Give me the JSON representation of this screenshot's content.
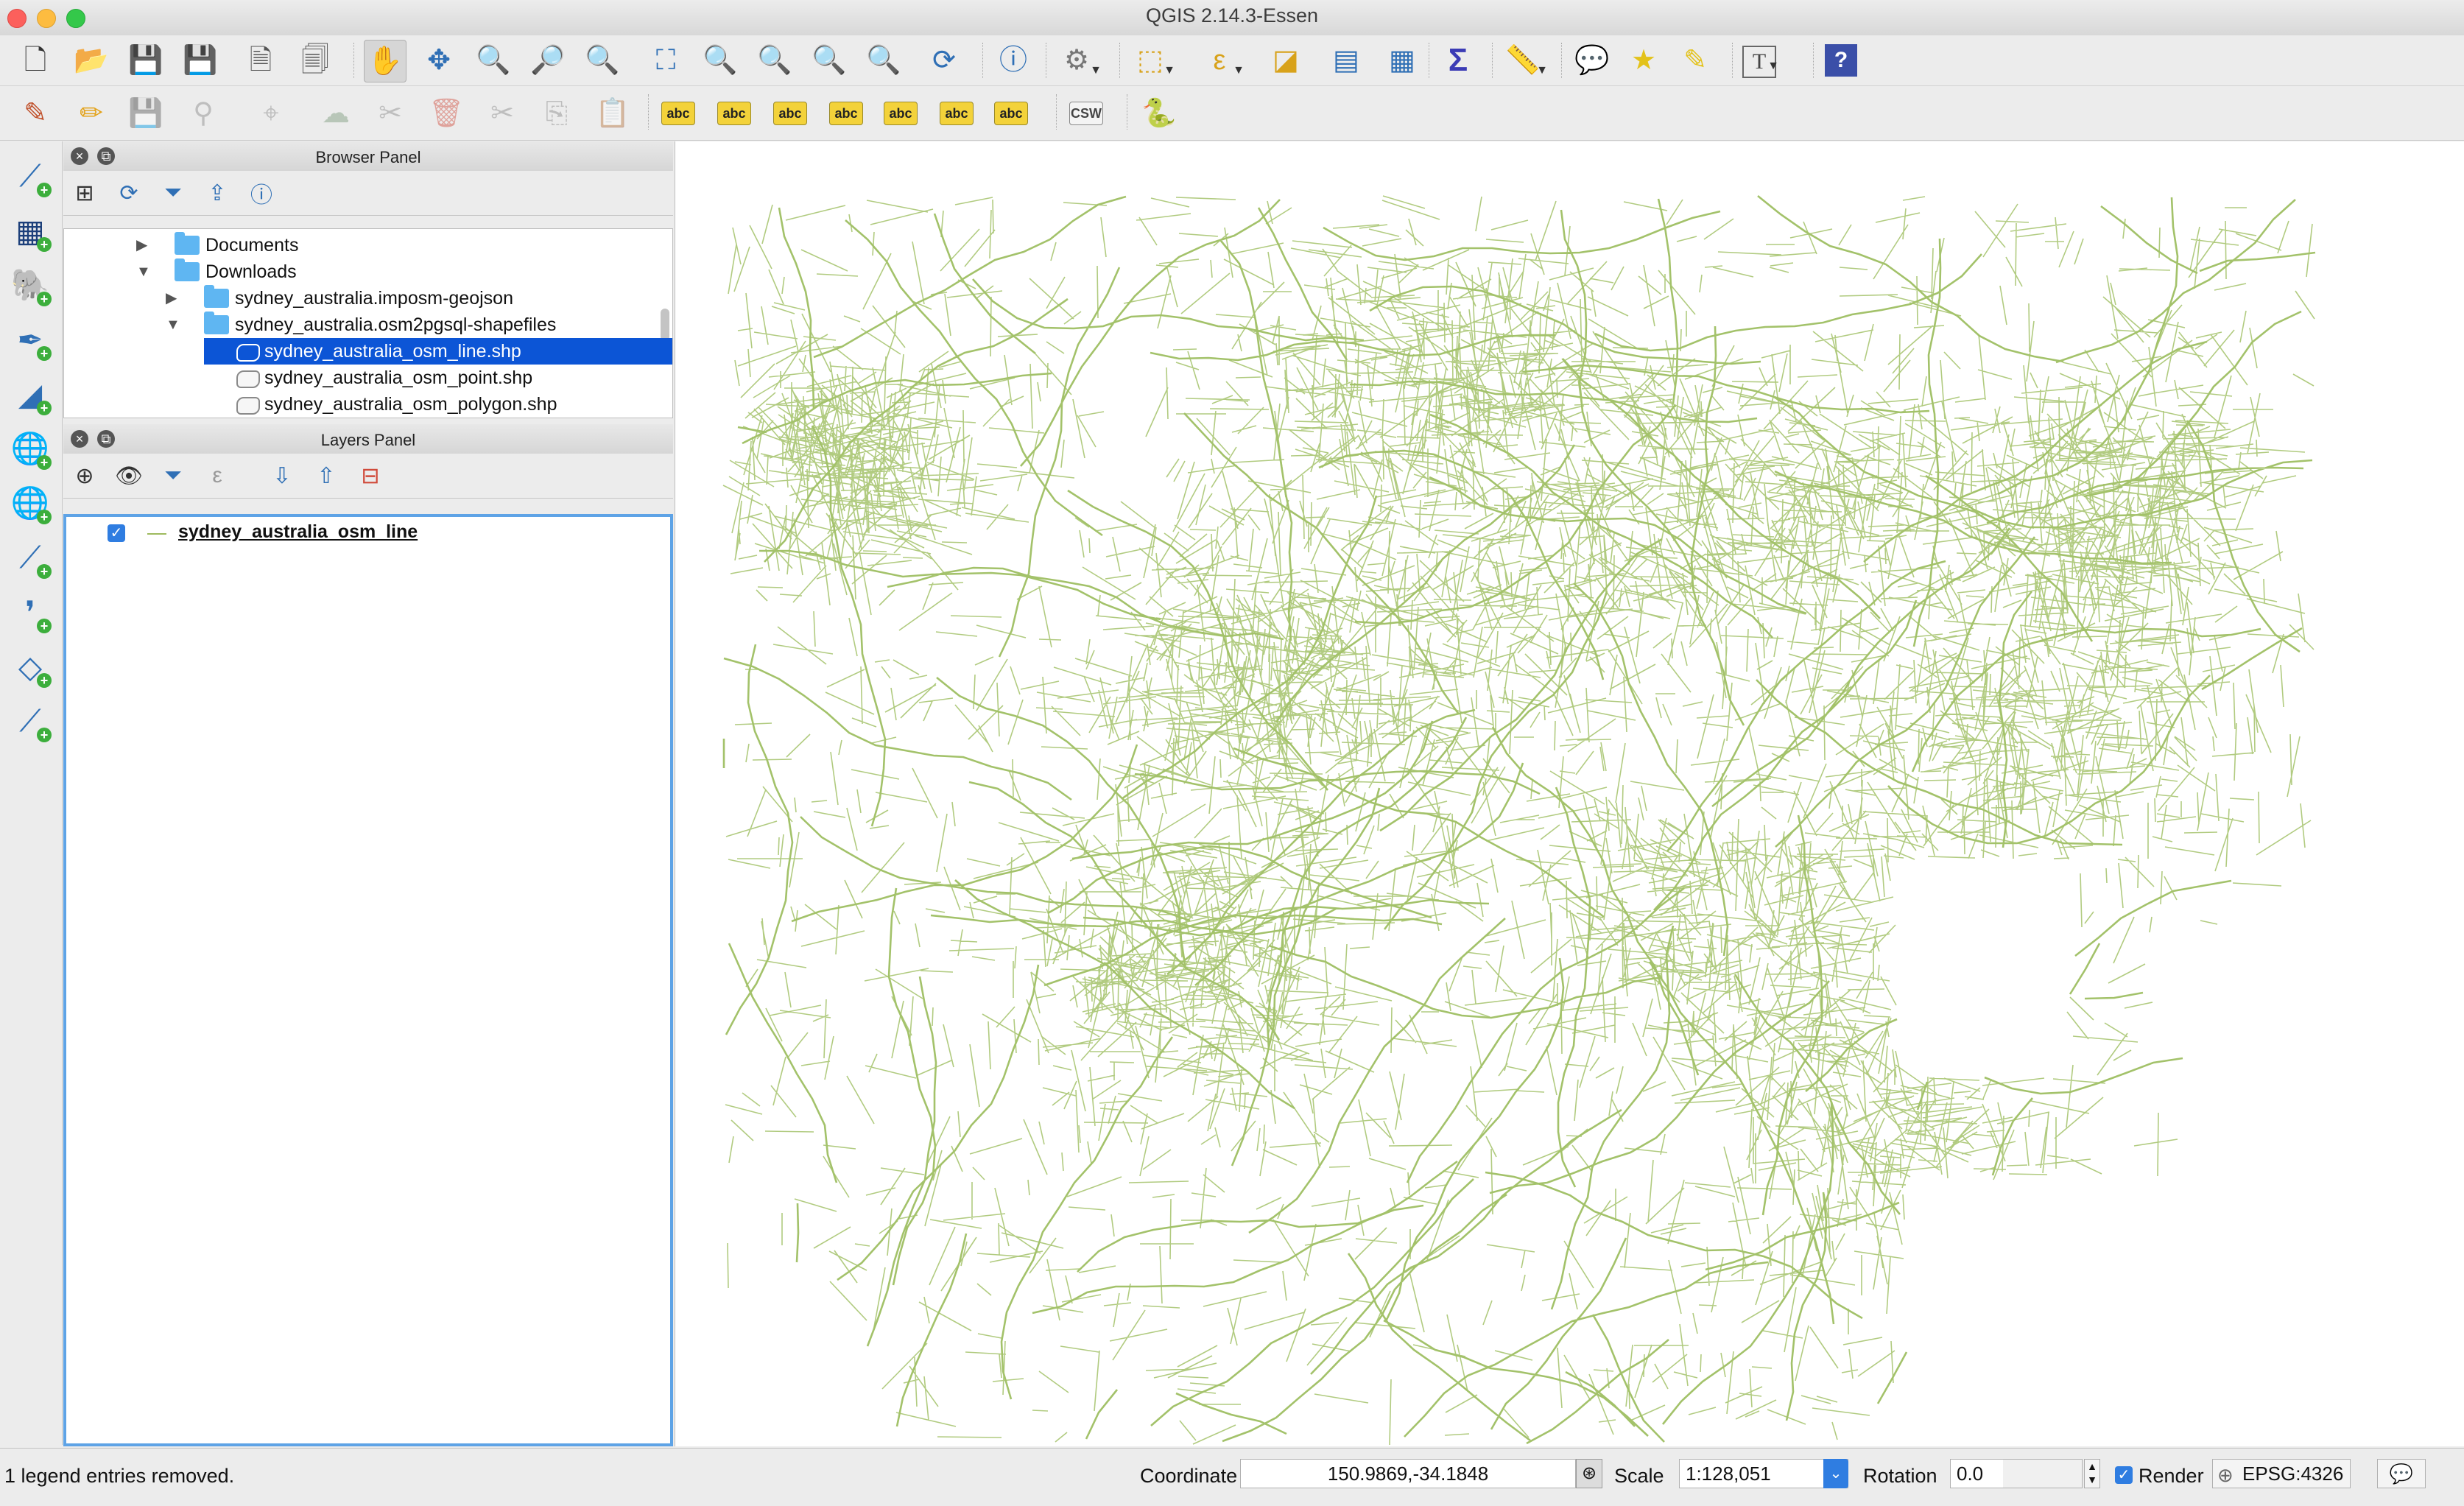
{
  "window": {
    "title": "QGIS 2.14.3-Essen"
  },
  "toolbar1": [
    {
      "name": "new-project-icon",
      "glyph": "🗋",
      "color": "#333"
    },
    {
      "name": "open-project-icon",
      "glyph": "📂",
      "color": "#e3a21a"
    },
    {
      "name": "save-project-icon",
      "glyph": "💾",
      "color": "#3a5b8c"
    },
    {
      "name": "save-as-icon",
      "glyph": "💾",
      "color": "#3a5b8c"
    },
    {
      "name": "new-print-composer-icon",
      "glyph": "🗎",
      "color": "#555"
    },
    {
      "name": "composer-manager-icon",
      "glyph": "🗐",
      "color": "#555"
    },
    {
      "name": "pan-icon",
      "glyph": "✋",
      "color": "#333"
    },
    {
      "name": "pan-to-selection-icon",
      "glyph": "✥",
      "color": "#2f6fb5"
    },
    {
      "name": "zoom-in-icon",
      "glyph": "🔍",
      "color": "#2f6fb5"
    },
    {
      "name": "zoom-out-icon",
      "glyph": "🔎",
      "color": "#2f6fb5"
    },
    {
      "name": "zoom-native-icon",
      "glyph": "🔍",
      "color": "#2f6fb5"
    },
    {
      "name": "zoom-full-icon",
      "glyph": "⛶",
      "color": "#2f6fb5"
    },
    {
      "name": "zoom-to-selection-icon",
      "glyph": "🔍",
      "color": "#2f6fb5"
    },
    {
      "name": "zoom-to-layer-icon",
      "glyph": "🔍",
      "color": "#2f6fb5"
    },
    {
      "name": "zoom-last-icon",
      "glyph": "🔍",
      "color": "#2f6fb5"
    },
    {
      "name": "zoom-next-icon",
      "glyph": "🔍",
      "color": "#2f6fb5"
    },
    {
      "name": "refresh-icon",
      "glyph": "⟳",
      "color": "#2f6fb5"
    },
    {
      "name": "identify-icon",
      "glyph": "ⓘ",
      "color": "#2f6fb5"
    },
    {
      "name": "action-icon",
      "glyph": "⚙",
      "color": "#777"
    },
    {
      "name": "select-features-icon",
      "glyph": "⬚",
      "color": "#d8a21a"
    },
    {
      "name": "select-by-expression-icon",
      "glyph": "ε",
      "color": "#d8a21a"
    },
    {
      "name": "deselect-icon",
      "glyph": "◪",
      "color": "#d8a21a"
    },
    {
      "name": "attribute-table-icon",
      "glyph": "▤",
      "color": "#2f6fb5"
    },
    {
      "name": "field-calculator-icon",
      "glyph": "▦",
      "color": "#2f6fb5"
    },
    {
      "name": "statistics-icon",
      "glyph": "Σ",
      "color": "#3b3bb5"
    },
    {
      "name": "measure-icon",
      "glyph": "📏",
      "color": "#555"
    },
    {
      "name": "map-tips-icon",
      "glyph": "💬",
      "color": "#e3c21a"
    },
    {
      "name": "new-bookmark-icon",
      "glyph": "★",
      "color": "#e3c21a"
    },
    {
      "name": "show-bookmarks-icon",
      "glyph": "✎",
      "color": "#e3c21a"
    },
    {
      "name": "text-annotation-icon",
      "glyph": "T",
      "color": "#444"
    },
    {
      "name": "help-icon",
      "glyph": "?",
      "color": "#fff"
    }
  ],
  "toolbar2": [
    {
      "name": "current-edits-icon",
      "glyph": "✎",
      "color": "#c0502a"
    },
    {
      "name": "toggle-editing-icon",
      "glyph": "✏",
      "color": "#e3a21a"
    },
    {
      "name": "save-edits-icon",
      "glyph": "💾",
      "color": "#888"
    },
    {
      "name": "add-feature-icon",
      "glyph": "⚲",
      "color": "#888"
    },
    {
      "name": "node-tool-icon",
      "glyph": "⌖",
      "color": "#888"
    },
    {
      "name": "move-feature-icon",
      "glyph": "☁",
      "color": "#7a9a7a"
    },
    {
      "name": "node-editor-icon",
      "glyph": "✂",
      "color": "#888"
    },
    {
      "name": "delete-selected-icon",
      "glyph": "🗑",
      "color": "#d04a3a"
    },
    {
      "name": "cut-features-icon",
      "glyph": "✂",
      "color": "#888"
    },
    {
      "name": "copy-features-icon",
      "glyph": "⎘",
      "color": "#888"
    },
    {
      "name": "paste-features-icon",
      "glyph": "📋",
      "color": "#888"
    },
    {
      "name": "label-tool-icon",
      "glyph": "abc",
      "color": "#222"
    },
    {
      "name": "pin-labels-icon",
      "glyph": "abc",
      "color": "#222"
    },
    {
      "name": "highlight-pinned-labels-icon",
      "glyph": "abc",
      "color": "#222"
    },
    {
      "name": "show-hide-labels-icon",
      "glyph": "abc",
      "color": "#222"
    },
    {
      "name": "move-label-icon",
      "glyph": "abc",
      "color": "#222"
    },
    {
      "name": "rotate-label-icon",
      "glyph": "abc",
      "color": "#222"
    },
    {
      "name": "change-label-icon",
      "glyph": "abc",
      "color": "#222"
    },
    {
      "name": "csw-icon",
      "glyph": "CSW",
      "color": "#444"
    },
    {
      "name": "python-console-icon",
      "glyph": "🐍",
      "color": "#3a6fb5"
    }
  ],
  "left_toolbar": [
    {
      "name": "add-vector-layer-icon",
      "glyph": "⟋"
    },
    {
      "name": "add-raster-layer-icon",
      "glyph": "▦"
    },
    {
      "name": "add-postgis-layer-icon",
      "glyph": "🐘"
    },
    {
      "name": "add-spatialite-layer-icon",
      "glyph": "✒"
    },
    {
      "name": "add-mssql-layer-icon",
      "glyph": "◢"
    },
    {
      "name": "add-wms-layer-icon",
      "glyph": "🌐"
    },
    {
      "name": "add-wcs-layer-icon",
      "glyph": "🌐"
    },
    {
      "name": "add-wfs-layer-icon",
      "glyph": "⟋"
    },
    {
      "name": "add-delimited-text-icon",
      "glyph": "❜"
    },
    {
      "name": "add-virtual-layer-icon",
      "glyph": "◇"
    },
    {
      "name": "new-shapefile-icon",
      "glyph": "⟋"
    }
  ],
  "browser_panel": {
    "title": "Browser Panel",
    "tools": [
      {
        "name": "add-selected-layers-icon",
        "glyph": "⊞",
        "color": "#333"
      },
      {
        "name": "refresh-browser-icon",
        "glyph": "⟳",
        "color": "#2f6fb5"
      },
      {
        "name": "filter-browser-icon",
        "glyph": "⏷",
        "color": "#2f6fb5"
      },
      {
        "name": "collapse-all-icon",
        "glyph": "⇪",
        "color": "#2f6fb5"
      },
      {
        "name": "properties-icon",
        "glyph": "ⓘ",
        "color": "#2f6fb5"
      }
    ],
    "items": [
      {
        "label": "Documents",
        "type": "folder",
        "indent": 0,
        "expanded": false
      },
      {
        "label": "Downloads",
        "type": "folder",
        "indent": 0,
        "expanded": true
      },
      {
        "label": "sydney_australia.imposm-geojson",
        "type": "folder",
        "indent": 1,
        "expanded": false
      },
      {
        "label": "sydney_australia.osm2pgsql-shapefiles",
        "type": "folder",
        "indent": 1,
        "expanded": true
      },
      {
        "label": "sydney_australia_osm_line.shp",
        "type": "shp",
        "indent": 2,
        "selected": true
      },
      {
        "label": "sydney_australia_osm_point.shp",
        "type": "shp",
        "indent": 2,
        "selected": false
      },
      {
        "label": "sydney_australia_osm_polygon.shp",
        "type": "shp",
        "indent": 2,
        "selected": false
      }
    ]
  },
  "layers_panel": {
    "title": "Layers Panel",
    "tools": [
      {
        "name": "add-group-icon",
        "glyph": "⊕",
        "color": "#333"
      },
      {
        "name": "manage-visibility-icon",
        "glyph": "👁",
        "color": "#333"
      },
      {
        "name": "filter-legend-icon",
        "glyph": "⏷",
        "color": "#2f6fb5"
      },
      {
        "name": "filter-by-expression-icon",
        "glyph": "ε",
        "color": "#999"
      },
      {
        "name": "expand-all-icon",
        "glyph": "⇩",
        "color": "#2f6fb5"
      },
      {
        "name": "collapse-all-layers-icon",
        "glyph": "⇧",
        "color": "#2f6fb5"
      },
      {
        "name": "remove-layer-icon",
        "glyph": "⊟",
        "color": "#d04a3a"
      }
    ],
    "layers": [
      {
        "label": "sydney_australia_osm_line",
        "visible": true,
        "symbol_color": "#9eba5e"
      }
    ]
  },
  "map": {
    "line_color": "#a3c26a",
    "background": "#ffffff"
  },
  "statusbar": {
    "message": "1 legend entries removed.",
    "coordinate_label": "Coordinate",
    "coordinate_value": "150.9869,-34.1848",
    "scale_label": "Scale",
    "scale_value": "1:128,051",
    "rotation_label": "Rotation",
    "rotation_value": "0.0",
    "render_label": "Render",
    "render_checked": true,
    "crs_label": "EPSG:4326"
  }
}
